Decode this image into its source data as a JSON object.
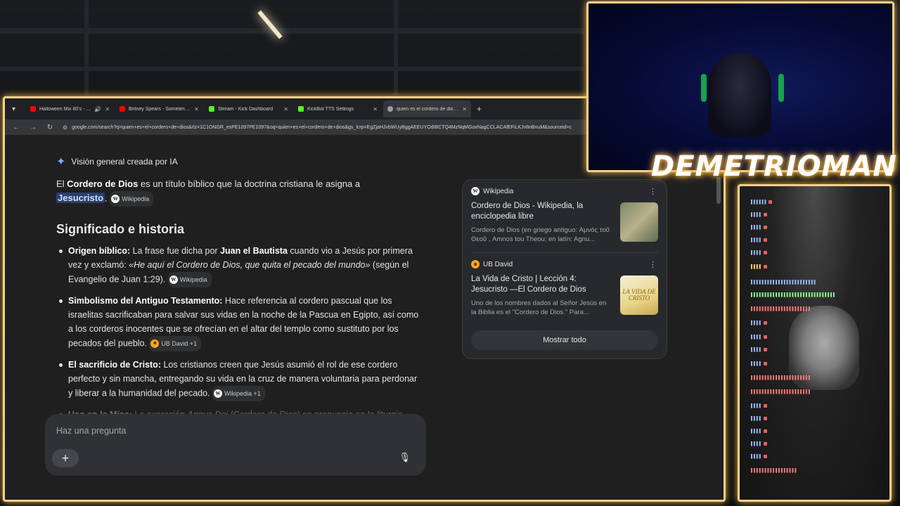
{
  "tabs": [
    {
      "title": "Halloween Mix 80's - YouTu",
      "favicon_color": "#ff0000",
      "active": false
    },
    {
      "title": "Britney Spears - Sometimes (C",
      "favicon_color": "#ff0000",
      "active": false
    },
    {
      "title": "Stream - Kick Dashboard",
      "favicon_color": "#53fc18",
      "active": false
    },
    {
      "title": "KickBot TTS Settings",
      "favicon_color": "#53fc18",
      "active": false
    },
    {
      "title": "quien es el cordero de dios - G",
      "favicon_color": "#9aa0a6",
      "active": true
    }
  ],
  "address": "google.com/search?q=quien+es+el+cordero+de+dios&rlz=1C1ONGR_esPE1097PE1097&oq=quien+es+el+cordero+de+dios&gs_lcrp=EgZjaHJvbWUyBggAEEUYOdIBCTQ4MzNqMGoxNagCCLACAfEFiLKJv8nBnuM&sourceid=c",
  "ai": {
    "header": "Visión general creada por IA",
    "intro_pre": "El ",
    "intro_bold": "Cordero de Dios",
    "intro_mid": " es un título bíblico que la doctrina cristiana le asigna a ",
    "intro_highlight": "Jesucristo",
    "intro_post": ".",
    "intro_chip": "Wikipedia",
    "section_title": "Significado e historia",
    "bullets": [
      {
        "bold": "Origen bíblico:",
        "pre": " La frase fue dicha por ",
        "bold2": "Juan el Bautista",
        "mid": " cuando vio a Jesús por primera vez y exclamó: ",
        "italic": "«He aquí el Cordero de Dios, que quita el pecado del mundo»",
        "post": " (según el Evangelio de Juan 1:29).",
        "chip": "Wikipedia"
      },
      {
        "bold": "Simbolismo del Antiguo Testamento:",
        "text": " Hace referencia al cordero pascual que los israelitas sacrificaban para salvar sus vidas en la noche de la Pascua en Egipto, así como a los corderos inocentes que se ofrecían en el altar del templo como sustituto por los pecados del pueblo.",
        "chip": "UB David +1"
      },
      {
        "bold": "El sacrificio de Cristo:",
        "text": " Los cristianos creen que Jesús asumió el rol de ese cordero perfecto y sin mancha, entregando su vida en la cruz de manera voluntaria para perdonar y liberar a la humanidad del pecado.",
        "chip": "Wikipedia +1"
      },
      {
        "bold": "Uso en la Misa:",
        "pre": " La expresión ",
        "italic": "Agnus Dei",
        "post": " (Cordero de Dios) se pronuncia en la liturgia"
      }
    ]
  },
  "sources": [
    {
      "site": "Wikipedia",
      "title": "Cordero de Dios - Wikipedia, la enciclopedia libre",
      "snippet": "Cordero de Dios (en griego antiguo: Αμνὸς τοῦ Θεοῦ , Amnos tou Theou; en latín: Agnu..."
    },
    {
      "site": "UB David",
      "title": "La Vida de Cristo | Lección 4: Jesucristo —El Cordero de Dios",
      "snippet": "Uno de los nombres dados al Señor Jesús en la Biblia es el \"Cordero de Dios.\" Para...",
      "thumb_text": "LA VIDA DE CRISTO"
    }
  ],
  "show_all": "Mostrar todo",
  "ask_placeholder": "Haz una pregunta",
  "streamer_name": "DEMETRIOMAN",
  "colors": {
    "frame": "#f5d089",
    "glow": "#f0b64a",
    "highlight_bg": "#2b3f6e",
    "accent_blue": "#7aa7ff"
  }
}
